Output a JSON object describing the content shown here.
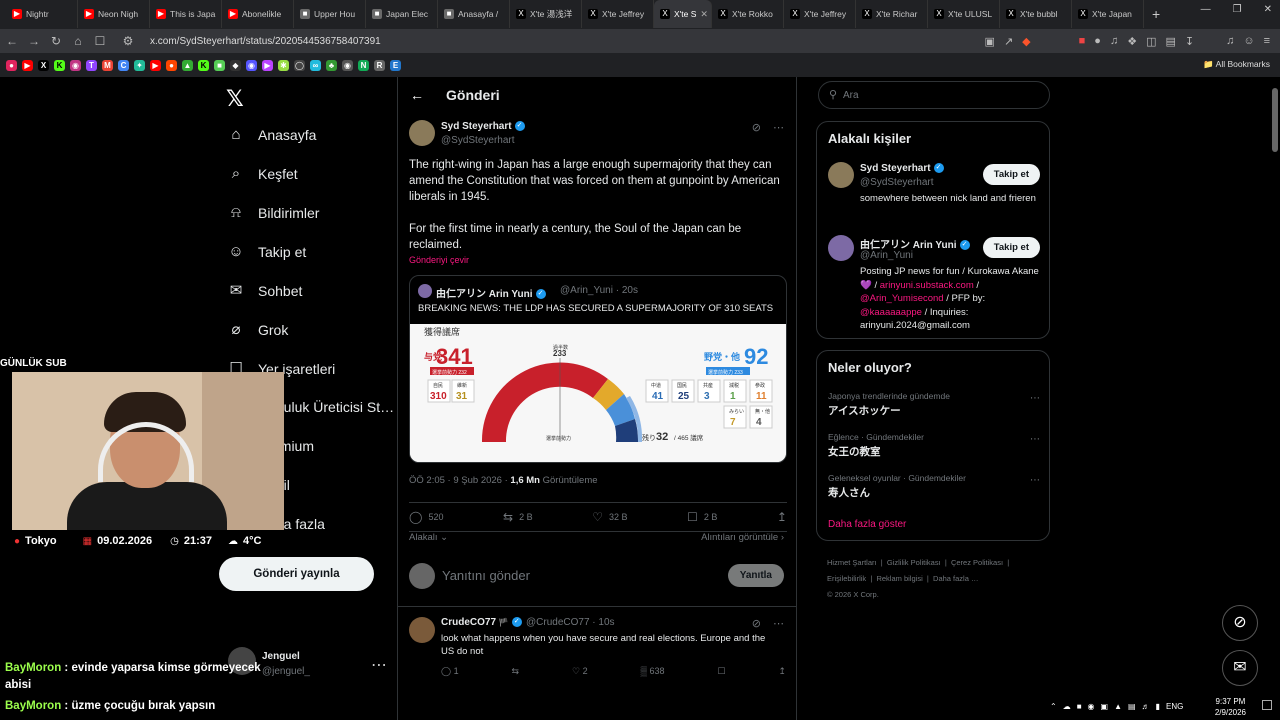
{
  "browser": {
    "tabs": [
      {
        "label": "Nightr",
        "fav": "yt"
      },
      {
        "label": "Neon Nigh",
        "fav": "yt"
      },
      {
        "label": "This is Japa",
        "fav": "yt"
      },
      {
        "label": "Aboneli̇kle",
        "fav": "yt"
      },
      {
        "label": "Upper Hou",
        "fav": "doc"
      },
      {
        "label": "Japan Elec",
        "fav": "doc"
      },
      {
        "label": "Anasayfa /",
        "fav": "doc"
      },
      {
        "label": "X'te 湯浅洋",
        "fav": "x"
      },
      {
        "label": "X'te Jeffrey",
        "fav": "x"
      },
      {
        "label": "X'te S",
        "fav": "x",
        "active": true
      },
      {
        "label": "X'te Rokko",
        "fav": "x"
      },
      {
        "label": "X'te Jeffrey",
        "fav": "x"
      },
      {
        "label": "X'te Richar",
        "fav": "x"
      },
      {
        "label": "X'te ULUSL",
        "fav": "x"
      },
      {
        "label": "X'te bubbl",
        "fav": "x"
      },
      {
        "label": "X'te Japan",
        "fav": "x"
      }
    ],
    "url": "x.com/SydSteyerhart/status/2020544536758407391",
    "all_bookmarks": "All Bookmarks"
  },
  "nav": {
    "items": [
      {
        "label": "Anasayfa",
        "icon": "home-icon",
        "glyph": "⌂"
      },
      {
        "label": "Keşfet",
        "icon": "search-icon",
        "glyph": "⌕"
      },
      {
        "label": "Bildirimler",
        "icon": "bell-icon",
        "glyph": "⍾"
      },
      {
        "label": "Takip et",
        "icon": "add-user-icon",
        "glyph": "☺"
      },
      {
        "label": "Sohbet",
        "icon": "mail-icon",
        "glyph": "✉"
      },
      {
        "label": "Grok",
        "icon": "grok-icon",
        "glyph": "⌀"
      },
      {
        "label": "Yer işaretleri",
        "icon": "bookmark-icon",
        "glyph": "☐"
      },
      {
        "label": "Topluluk Üreticisi St…",
        "icon": "lightning-icon",
        "glyph": "ϟ"
      },
      {
        "label": "Premium",
        "icon": "premium-icon",
        "glyph": "X"
      },
      {
        "label": "Profil",
        "icon": "profile-icon",
        "glyph": "☺"
      },
      {
        "label": "Daha fazla",
        "icon": "more-icon",
        "glyph": "…"
      }
    ],
    "post_button": "Gönderi yayınla",
    "account": {
      "name": "Jenguel",
      "handle": "@jenguel_"
    }
  },
  "main": {
    "title": "Gönderi",
    "tweet": {
      "name": "Syd Steyerhart",
      "handle": "@SydSteyerhart",
      "text1": "The right-wing in Japan has a large enough supermajority that they can amend the Constitution that was forced on them at gunpoint by American liberals in 1945.",
      "text2": "For the first time in nearly a century, the Soul of the Japan can be reclaimed.",
      "translate": "Gönderiyi çevir",
      "quote": {
        "name": "由仁アリン Arin Yuni",
        "handle": "@Arin_Yuni · 20s",
        "text": "BREAKING NEWS: THE LDP HAS SECURED A SUPERMAJORITY OF 310 SEATS",
        "image": {
          "header": "獲得議席",
          "ruling_label": "与党",
          "ruling_total": "341",
          "ruling_sub": "選挙前勢力 232",
          "ldp_label": "自民",
          "ldp_value": "310",
          "ishin_label": "維新",
          "ishin_value": "31",
          "majority_label": "過半数",
          "majority_value": "233",
          "opposition_label": "野党・他",
          "opposition_total": "92",
          "opposition_sub": "選挙前勢力 233",
          "opp_parties": [
            {
              "label": "中道",
              "value": "41",
              "color": "#2a6cb5"
            },
            {
              "label": "国民",
              "value": "25",
              "color": "#1f3e7a"
            },
            {
              "label": "共産",
              "value": "3",
              "color": "#2f6fb0"
            },
            {
              "label": "減税",
              "value": "1",
              "color": "#5ba04a"
            },
            {
              "label": "参政",
              "value": "11",
              "color": "#e08030"
            },
            {
              "label": "みらい",
              "value": "7",
              "color": "#c49a2a"
            },
            {
              "label": "無・他",
              "value": "4",
              "color": "#555"
            }
          ],
          "remaining_label": "残り",
          "remaining_value": "32",
          "total": "/ 465 議席",
          "center_label": "選挙前勢力"
        }
      },
      "time": "ÖÖ 2:05 · 9 Şub 2026 ·",
      "views_count": "1,6 Mn",
      "views_label": "Görüntüleme",
      "stats": {
        "replies": "520",
        "reposts": "2 B",
        "likes": "32 B",
        "bookmarks": "2 B"
      },
      "relevance": "Alakalı",
      "quotes_link": "Alıntıları görüntüle"
    },
    "reply_box": {
      "placeholder": "Yanıtını gönder",
      "button": "Yanıtla"
    },
    "reply": {
      "name": "CrudeCO77",
      "handle": "@CrudeCO77 · 10s",
      "text": "look what happens when you have secure and real elections. Europe and the US do not",
      "replies": "1",
      "reposts": "",
      "likes": "2",
      "views": "638"
    }
  },
  "sidebar": {
    "search_placeholder": "Ara",
    "people_title": "Alakalı kişiler",
    "people": [
      {
        "name": "Syd Steyerhart",
        "handle": "@SydSteyerhart",
        "bio": "somewhere between nick land and frieren",
        "follow": "Takip et"
      },
      {
        "name": "由仁アリン Arin Yuni",
        "handle": "@Arin_Yuni",
        "bio_1": "Posting JP news for fun / Kurokawa Akane💜 / ",
        "bio_link1": "arinyuni.substack.com",
        "bio_2": " / ",
        "bio_link2": "@Arin_Yumisecond",
        "bio_3": " / PFP by: ",
        "bio_link3": "@kaaaaaappe",
        "bio_4": " / Inquiries: arinyuni.2024@gmail.com",
        "follow": "Takip et"
      }
    ],
    "trends_title": "Neler oluyor?",
    "trends": [
      {
        "context": "Japonya trendlerinde gündemde",
        "name": "アイスホッケー"
      },
      {
        "context": "Eğlence · Gündemdekiler",
        "name": "女王の教室"
      },
      {
        "context": "Geleneksel oyunlar · Gündemdekiler",
        "name": "寿人さん"
      }
    ],
    "show_more": "Daha fazla göster",
    "footer": [
      "Hizmet Şartları",
      "Gizlilik Politikası",
      "Çerez Politikası",
      "Erişilebilirlik",
      "Reklam bilgisi",
      "Daha fazla …",
      "© 2026 X Corp."
    ]
  },
  "stream": {
    "label": "GÜNLÜK SUB",
    "location": "Tokyo",
    "date": "09.02.2026",
    "time": "21:37",
    "weather": "4°C",
    "chat": [
      {
        "user": "BayMoron",
        "text": " : evinde yaparsa kimse görmeyecek abisi"
      },
      {
        "user": "BayMoron",
        "text": " : üzme çocuğu bırak yapsın"
      }
    ]
  },
  "system": {
    "lang": "ENG",
    "clock_time": "9:37 PM",
    "clock_date": "2/9/2026"
  },
  "colors": {
    "accent": "#f91880",
    "verified": "#1d9bf0",
    "ldp_red": "#c8202b",
    "opp_blue": "#2d8ae0"
  }
}
